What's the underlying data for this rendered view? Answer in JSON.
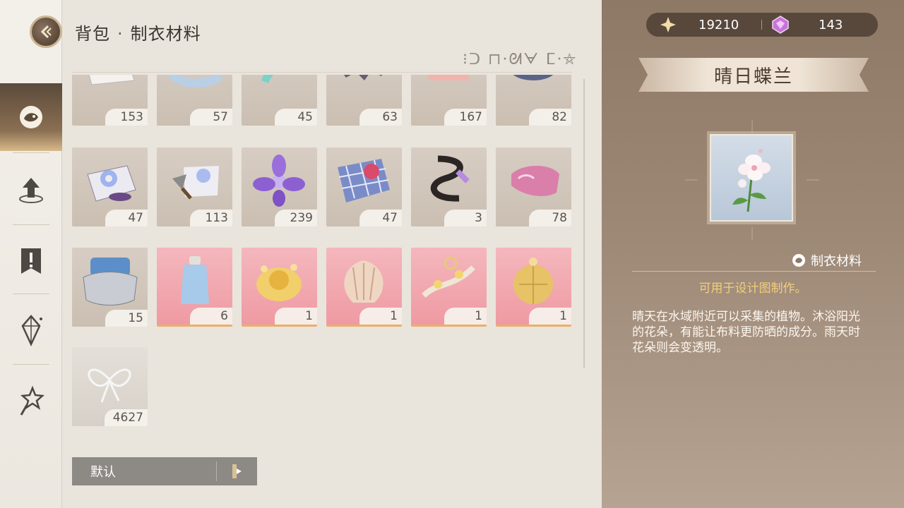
{
  "header": {
    "title": "背包",
    "subtitle": "制衣材料",
    "dot": "·"
  },
  "deco_script": "⁝ᑐ ⊓·ᘛᗄ ⵎ·⛤",
  "items": [
    {
      "count": "153",
      "style": "tan",
      "icon": "cloth-fragment-icon"
    },
    {
      "count": "57",
      "style": "tan",
      "icon": "blue-shoe-icon"
    },
    {
      "count": "45",
      "style": "tan",
      "icon": "teal-ribbon-icon"
    },
    {
      "count": "63",
      "style": "tan",
      "icon": "bat-wing-icon"
    },
    {
      "count": "167",
      "style": "tan",
      "icon": "pink-fabric-icon"
    },
    {
      "count": "82",
      "style": "tan",
      "icon": "navy-cap-icon"
    },
    {
      "count": "47",
      "style": "tan",
      "icon": "swirl-bucket-icon"
    },
    {
      "count": "113",
      "style": "tan",
      "icon": "trowel-cloth-icon"
    },
    {
      "count": "239",
      "style": "tan",
      "icon": "purple-flower-icon"
    },
    {
      "count": "47",
      "style": "tan",
      "icon": "plaid-fabric-icon"
    },
    {
      "count": "3",
      "style": "tan",
      "icon": "black-ribbon-icon"
    },
    {
      "count": "78",
      "style": "tan",
      "icon": "pink-shoe-icon"
    },
    {
      "count": "15",
      "style": "tan",
      "icon": "silver-pouch-icon"
    },
    {
      "count": "6",
      "style": "pink",
      "icon": "glass-bottle-icon"
    },
    {
      "count": "1",
      "style": "pink",
      "icon": "golden-flower-icon"
    },
    {
      "count": "1",
      "style": "pink",
      "icon": "seashell-icon"
    },
    {
      "count": "1",
      "style": "pink",
      "icon": "golden-branch-icon"
    },
    {
      "count": "1",
      "style": "pink",
      "icon": "golden-orb-icon"
    },
    {
      "count": "4627",
      "style": "grey",
      "icon": "silver-bow-icon"
    }
  ],
  "sortbar": {
    "label": "默认"
  },
  "currency": {
    "gold": "19210",
    "gem": "143"
  },
  "detail": {
    "name": "晴日蝶兰",
    "type": "制衣材料",
    "usage": "可用于设计图制作。",
    "description": "晴天在水域附近可以采集的植物。沐浴阳光的花朵，有能让布料更防晒的成分。雨天时花朵则会变透明。"
  },
  "colors": {
    "accent_gold": "#f2cf7a",
    "pink_tile": "#f4b7bd",
    "tan_tile": "#d7cdc3"
  }
}
